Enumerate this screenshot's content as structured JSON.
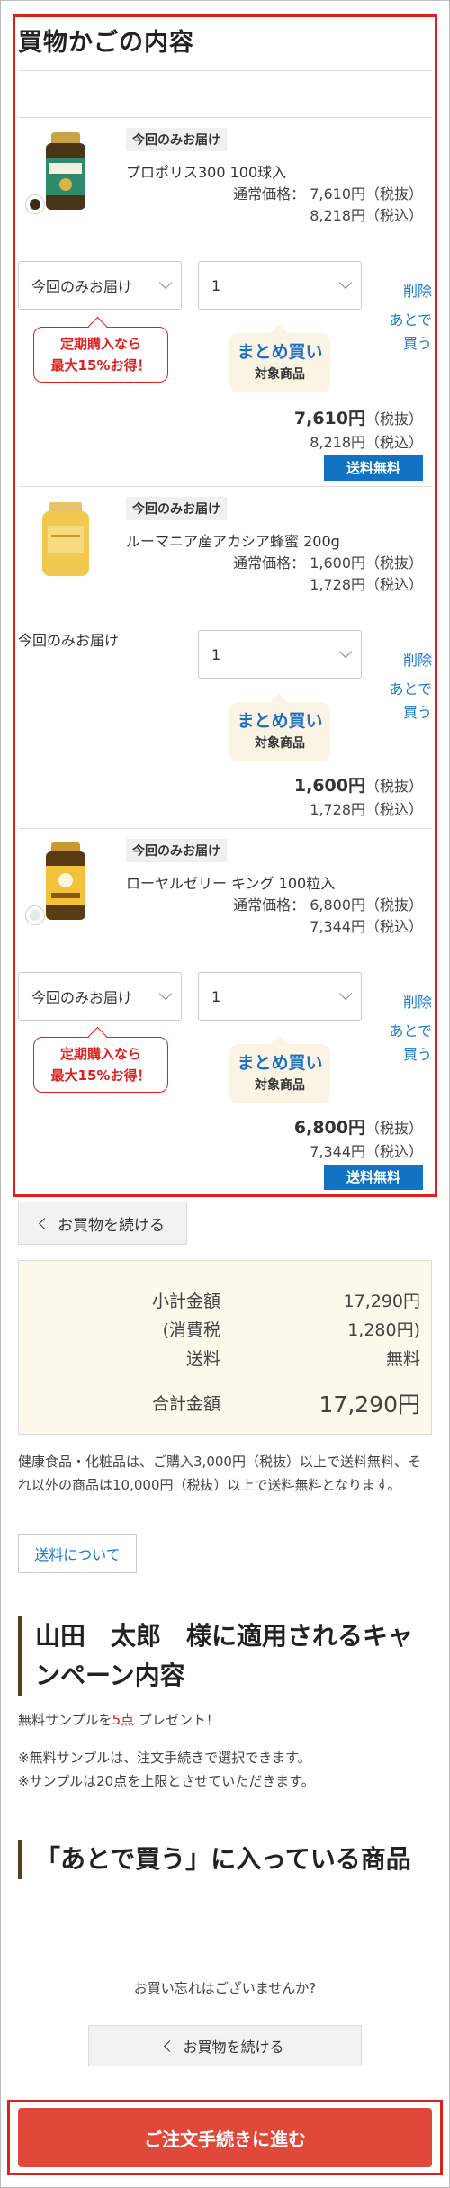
{
  "cart": {
    "title": "買物かごの内容",
    "items": [
      {
        "delivery_tag": "今回のみお届け",
        "name": "プロポリス300 100球入",
        "regular_price_label": "通常価格：",
        "regular_price": "7,610円（税抜）",
        "regular_price_tax": "8,218円（税込）",
        "delivery_select": "今回のみお届け",
        "quantity": "1",
        "teiki_promo_line1": "定期購入なら",
        "teiki_promo_line2": "最大15%お得！",
        "matome_line1": "まとめ買い",
        "matome_line2": "対象商品",
        "delete_label": "削除",
        "later_label": "あとで買う",
        "total_price": "7,610円",
        "total_tax_suffix": "（税抜）",
        "total_price_tax": "8,218円（税込）",
        "free_shipping_badge": "送料無料",
        "swatch_color": "#3a2a12"
      },
      {
        "delivery_tag": "今回のみお届け",
        "name": "ルーマニア産アカシア蜂蜜 200g",
        "regular_price_label": "通常価格：",
        "regular_price": "1,600円（税抜）",
        "regular_price_tax": "1,728円（税込）",
        "delivery_text": "今回のみお届け",
        "quantity": "1",
        "matome_line1": "まとめ買い",
        "matome_line2": "対象商品",
        "delete_label": "削除",
        "later_label": "あとで買う",
        "total_price": "1,600円",
        "total_tax_suffix": "（税抜）",
        "total_price_tax": "1,728円（税込）"
      },
      {
        "delivery_tag": "今回のみお届け",
        "name": "ローヤルゼリー キング 100粒入",
        "regular_price_label": "通常価格：",
        "regular_price": "6,800円（税抜）",
        "regular_price_tax": "7,344円（税込）",
        "delivery_select": "今回のみお届け",
        "quantity": "1",
        "teiki_promo_line1": "定期購入なら",
        "teiki_promo_line2": "最大15%お得！",
        "matome_line1": "まとめ買い",
        "matome_line2": "対象商品",
        "delete_label": "削除",
        "later_label": "あとで買う",
        "total_price": "6,800円",
        "total_tax_suffix": "（税抜）",
        "total_price_tax": "7,344円（税込）",
        "free_shipping_badge": "送料無料",
        "swatch_color": "#e8e8e8"
      }
    ],
    "continue_label": "お買物を続ける"
  },
  "summary": {
    "subtotal_label": "小計金額",
    "subtotal_value": "17,290円",
    "tax_label": "(消費税",
    "tax_value": "1,280円)",
    "shipping_label": "送料",
    "shipping_value": "無料",
    "total_label": "合計金額",
    "total_value": "17,290円"
  },
  "shipping_note": "健康食品・化粧品は、ご購入3,000円（税抜）以上で送料無料、それ以外の商品は10,000円（税抜）以上で送料無料となります。",
  "shipping_link": "送料について",
  "campaign": {
    "title": "山田　太郎　様に適用されるキャンペーン内容",
    "sample_prefix": "無料サンプルを",
    "sample_count": "5点",
    "sample_suffix": " プレゼント！",
    "note1": "※無料サンプルは、注文手続きで選択できます。",
    "note2": "※サンプルは20点を上限とさせていただきます。"
  },
  "later": {
    "title": "「あとで買う」に入っている商品",
    "empty_text": "お買い忘れはございませんか?",
    "continue_label": "お買物を続ける"
  },
  "order_button": "ご注文手続きに進む",
  "colors": {
    "accent_red": "#e0201e",
    "order_button": "#e0483a",
    "link_blue": "#1a79d4",
    "badge_blue": "#1272c4",
    "summary_bg": "#fdf8ec"
  }
}
